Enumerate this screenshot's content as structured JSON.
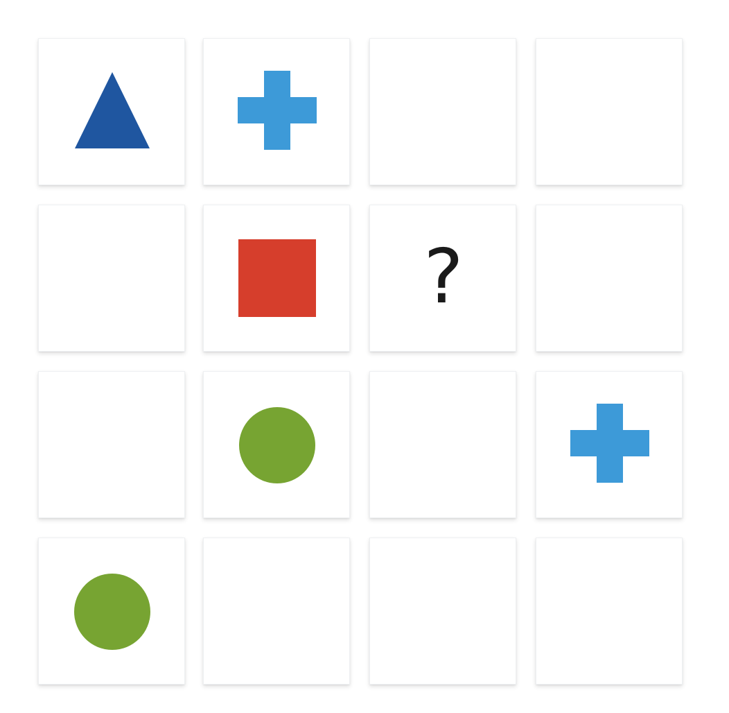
{
  "puzzle": {
    "rows": 4,
    "cols": 4,
    "cells": [
      {
        "shape": "triangle",
        "color": "#1f56a0"
      },
      {
        "shape": "cross",
        "color": "#3d9ad8"
      },
      {
        "shape": "empty"
      },
      {
        "shape": "empty"
      },
      {
        "shape": "empty"
      },
      {
        "shape": "square",
        "color": "#d63e2c"
      },
      {
        "shape": "question",
        "text": "?"
      },
      {
        "shape": "empty"
      },
      {
        "shape": "empty"
      },
      {
        "shape": "circle",
        "color": "#77a432"
      },
      {
        "shape": "empty"
      },
      {
        "shape": "cross",
        "color": "#3d9ad8"
      },
      {
        "shape": "circle",
        "color": "#77a432"
      },
      {
        "shape": "empty"
      },
      {
        "shape": "empty"
      },
      {
        "shape": "empty"
      }
    ]
  }
}
